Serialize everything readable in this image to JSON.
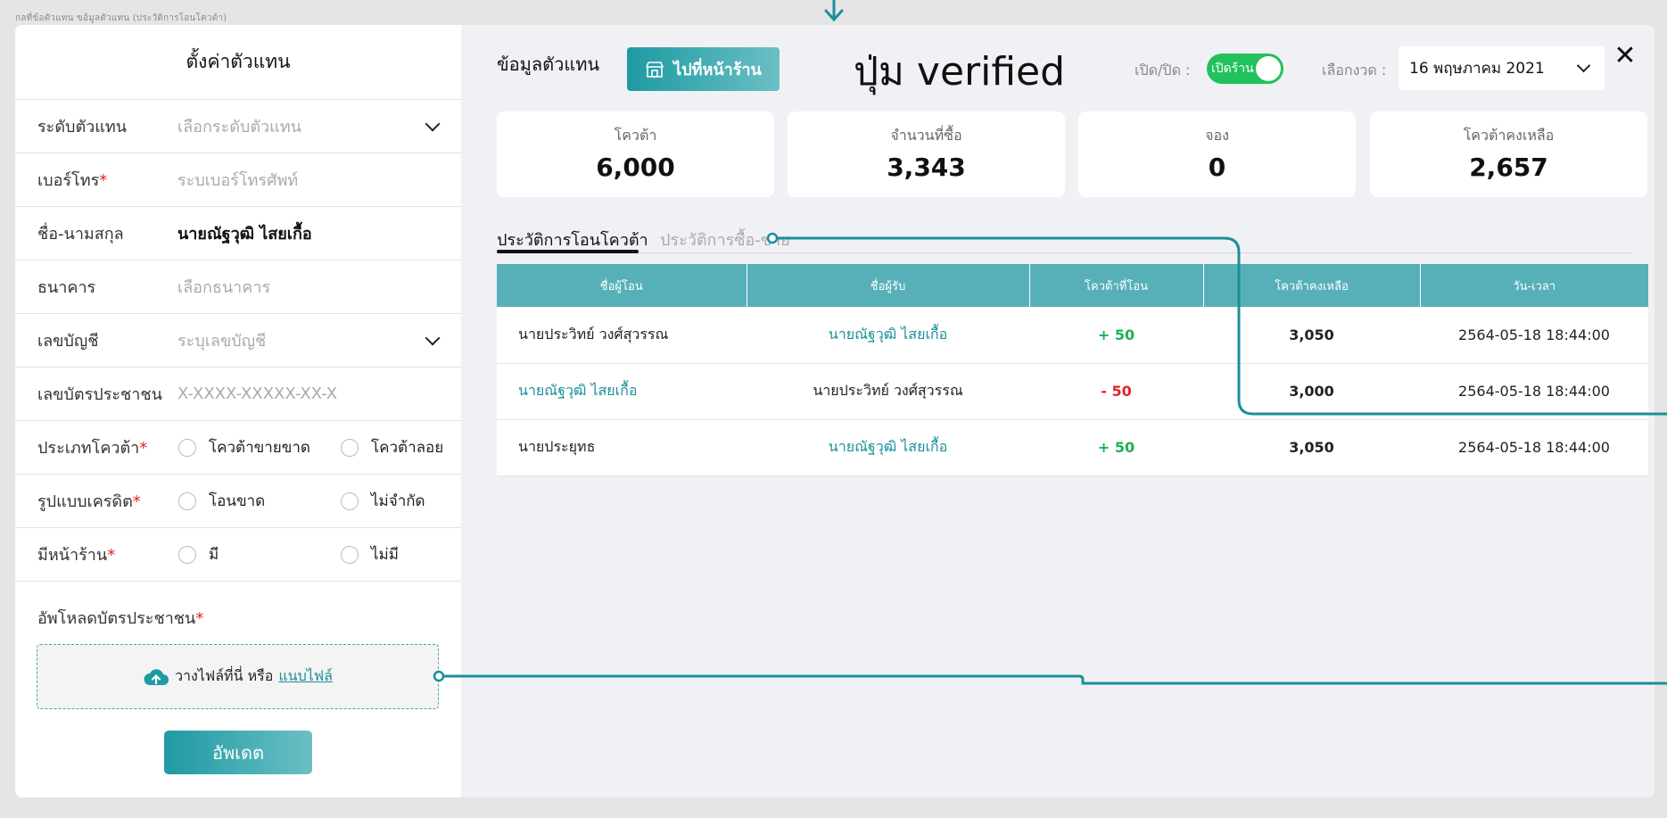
{
  "breadcrumb": "กลที่ข้อตัวแทน ขอ้มูลตัวแทน (ประวัติการโอนโควต้า)",
  "left": {
    "title": "ตั้งค่าตัวแทน",
    "fields": {
      "level": {
        "label": "ระดับตัวแทน",
        "placeholder": "เลือกระดับตัวแทน"
      },
      "phone": {
        "label": "เบอร์โทร",
        "required": "*",
        "placeholder": "ระบเบอร์โทรศัพท์"
      },
      "name": {
        "label": "ชื่อ-นามสกุล",
        "value": "นายณัฐวุฒิ ไสยเกื้อ"
      },
      "bank": {
        "label": "ธนาคาร",
        "placeholder": "เลือกธนาคาร"
      },
      "account": {
        "label": "เลขบัญชี",
        "placeholder": "ระบุเลขบัญชี"
      },
      "idcard": {
        "label": "เลขบัตรประชาชน",
        "placeholder": "X-XXXX-XXXXX-XX-X"
      },
      "quota_type": {
        "label": "ประเภทโควต้า",
        "required": "*",
        "options": [
          "โควต้าขายขาด",
          "โควต้าลอย"
        ]
      },
      "credit_type": {
        "label": "รูปแบบเครดิต",
        "required": "*",
        "options": [
          "โอนขาด",
          "ไม่จำกัด"
        ]
      },
      "storefront": {
        "label": "มีหน้าร้าน",
        "required": "*",
        "options": [
          "มี",
          "ไม่มี"
        ]
      }
    },
    "upload": {
      "label": "อัพโหลดบัตรประชาชน",
      "required": "*",
      "drop_text": "วางไฟล์ที่นี่ หรือ",
      "browse_link": "แนบไฟล์"
    },
    "update_button": "อัพเดต"
  },
  "right": {
    "title": "ข้อมูลตัวแทน",
    "shop_button": "ไปที่หน้าร้าน",
    "annotation": "ปุ่ม verified",
    "toggle": {
      "label": "เปิด/ปิด :",
      "state_text": "เปิดร้าน",
      "on": true
    },
    "period": {
      "label": "เลือกงวด :",
      "value": "16 พฤษภาคม 2021"
    },
    "stats": [
      {
        "label": "โควต้า",
        "value": "6,000"
      },
      {
        "label": "จำนวนที่ซื้อ",
        "value": "3,343"
      },
      {
        "label": "จอง",
        "value": "0"
      },
      {
        "label": "โควต้าคงเหลือ",
        "value": "2,657"
      }
    ],
    "tabs": [
      {
        "label": "ประวัติการโอนโควต้า",
        "active": true
      },
      {
        "label": "ประวัติการซื้อ-ขาย",
        "active": false
      }
    ],
    "table": {
      "headers": [
        "ชื่อผู้โอน",
        "ชื่อผู้รับ",
        "โควต้าที่โอน",
        "โควต้าคงเหลือ",
        "วัน-เวลา"
      ],
      "rows": [
        {
          "sender": "นายประวิทย์ วงศ์สุวรรณ",
          "receiver": "นายณัฐวุฒิ ไสยเกื้อ",
          "amount": "+ 50",
          "remaining": "3,050",
          "datetime": "2564-05-18 18:44:00"
        },
        {
          "sender": "นายณัฐวุฒิ ไสยเกื้อ",
          "receiver": "นายประวิทย์ วงศ์สุวรรณ",
          "amount": "- 50",
          "remaining": "3,000",
          "datetime": "2564-05-18 18:44:00"
        },
        {
          "sender": "นายประยุทธ",
          "receiver": "นายณัฐวุฒิ ไสยเกื้อ",
          "amount": "+ 50",
          "remaining": "3,050",
          "datetime": "2564-05-18 18:44:00"
        }
      ]
    }
  },
  "colors": {
    "accent": "#1e9aa3",
    "table_header": "#57b0b8",
    "positive": "#1cb154",
    "negative": "#e0242e",
    "toggle_on": "#21c15c"
  }
}
